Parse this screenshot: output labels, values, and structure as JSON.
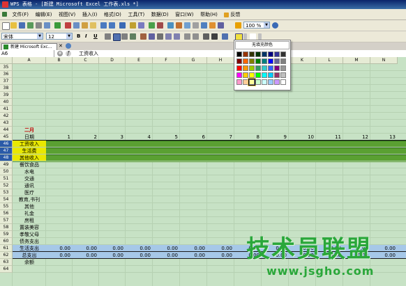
{
  "window": {
    "title": "WPS 表格 - [新建 Microsoft Excel 工作表.xls *]"
  },
  "menu": [
    "文件(F)",
    "编辑(E)",
    "视图(V)",
    "插入(I)",
    "格式(O)",
    "工具(T)",
    "数据(D)",
    "窗口(W)",
    "帮助(H)",
    "反馈"
  ],
  "toolbar": {
    "zoom": "100 %",
    "font_name": "宋体",
    "font_size": "12",
    "bold": "B",
    "italic": "I",
    "underline": "U"
  },
  "document_tab": {
    "label": "新建 Microsoft Exc..."
  },
  "formula_bar": {
    "cell_ref": "A6",
    "content": "工资收入"
  },
  "color_palette": {
    "no_fill_label": "无填充颜色",
    "colors": [
      "#000000",
      "#993300",
      "#333300",
      "#003300",
      "#003366",
      "#000080",
      "#333399",
      "#333333",
      "#800000",
      "#FF6600",
      "#808000",
      "#008000",
      "#008080",
      "#0000FF",
      "#666699",
      "#808080",
      "#FF0000",
      "#FF9900",
      "#99CC00",
      "#339966",
      "#33CCCC",
      "#3366FF",
      "#800080",
      "#969696",
      "#FF00FF",
      "#FFCC00",
      "#FFFF00",
      "#00FF00",
      "#00FFFF",
      "#00CCFF",
      "#993366",
      "#C0C0C0",
      "#FF99CC",
      "#FFCC99",
      "#FFFF99",
      "#CCFFCC",
      "#CCFFFF",
      "#99CCFF",
      "#CC99FF",
      "#FFFFFF"
    ],
    "selected_index": 34
  },
  "sheet": {
    "columns": [
      "A",
      "B",
      "C",
      "D",
      "E",
      "F",
      "G",
      "H",
      "I",
      "J",
      "K",
      "L",
      "M",
      "N"
    ],
    "rows": [
      {
        "n": "35",
        "a": "",
        "vals": []
      },
      {
        "n": "36",
        "a": "",
        "vals": []
      },
      {
        "n": "37",
        "a": "",
        "vals": []
      },
      {
        "n": "38",
        "a": "",
        "vals": []
      },
      {
        "n": "39",
        "a": "",
        "vals": []
      },
      {
        "n": "40",
        "a": "",
        "vals": []
      },
      {
        "n": "41",
        "a": "",
        "vals": []
      },
      {
        "n": "42",
        "a": "",
        "vals": []
      },
      {
        "n": "43",
        "a": "",
        "vals": []
      },
      {
        "n": "44",
        "a": "二月",
        "vals": [],
        "style": "title"
      },
      {
        "n": "45",
        "a": "日期",
        "vals": [
          "1",
          "2",
          "3",
          "4",
          "5",
          "6",
          "7",
          "8",
          "9",
          "10",
          "11",
          "12",
          "13"
        ],
        "style": "date"
      },
      {
        "n": "46",
        "a": "工资收入",
        "vals": [],
        "style": "income",
        "active": true
      },
      {
        "n": "47",
        "a": "生活费",
        "vals": [],
        "style": "income",
        "active": true
      },
      {
        "n": "48",
        "a": "其他收入",
        "vals": [],
        "style": "income",
        "active": true
      },
      {
        "n": "49",
        "a": "餐饮食品",
        "vals": []
      },
      {
        "n": "50",
        "a": "水电",
        "vals": []
      },
      {
        "n": "51",
        "a": "交通",
        "vals": []
      },
      {
        "n": "52",
        "a": "通讯",
        "vals": []
      },
      {
        "n": "53",
        "a": "医疗",
        "vals": []
      },
      {
        "n": "54",
        "a": "教育,书刊",
        "vals": []
      },
      {
        "n": "55",
        "a": "其他",
        "vals": []
      },
      {
        "n": "56",
        "a": "礼金",
        "vals": []
      },
      {
        "n": "57",
        "a": "房租",
        "vals": []
      },
      {
        "n": "58",
        "a": "置装美容",
        "vals": []
      },
      {
        "n": "59",
        "a": "孝敬父母",
        "vals": []
      },
      {
        "n": "60",
        "a": "债务支出",
        "vals": []
      },
      {
        "n": "61",
        "a": "生活支出",
        "vals": [
          "0.00",
          "0.00",
          "0.00",
          "0.00",
          "0.00",
          "0.00",
          "0.00",
          "0.00",
          "0.00",
          "0.00",
          "0.00",
          "0.00",
          "0.00"
        ],
        "style": "total"
      },
      {
        "n": "62",
        "a": "总支出",
        "vals": [
          "0.00",
          "0.00",
          "0.00",
          "0.00",
          "0.00",
          "0.00",
          "0.00",
          "0.00",
          "0.00",
          "0.00",
          "0.00",
          "0.00",
          "0.00"
        ],
        "style": "total"
      },
      {
        "n": "63",
        "a": "余额",
        "vals": []
      },
      {
        "n": "64",
        "a": "",
        "vals": []
      }
    ]
  },
  "watermark": {
    "text": "技术员联盟",
    "url": "www.jsgho.com"
  }
}
